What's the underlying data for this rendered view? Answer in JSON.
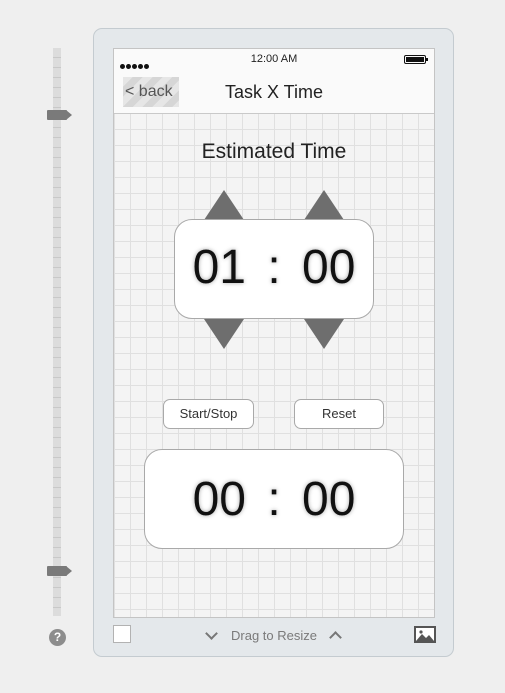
{
  "status_bar": {
    "time": "12:00 AM"
  },
  "nav": {
    "back_label": "< back",
    "title": "Task X Time"
  },
  "estimated": {
    "heading": "Estimated Time",
    "hours": "01",
    "separator": ":",
    "minutes": "00"
  },
  "buttons": {
    "start_stop": "Start/Stop",
    "reset": "Reset"
  },
  "timer": {
    "minutes": "00",
    "separator": ":",
    "seconds": "00"
  },
  "frame_toolbar": {
    "resize_label": "Drag to Resize"
  },
  "help": {
    "symbol": "?"
  },
  "icons": [
    "help-icon",
    "signal-icon",
    "battery-icon",
    "arrow-up-icon",
    "arrow-down-icon",
    "chevron-down-icon",
    "chevron-up-icon",
    "image-icon"
  ]
}
